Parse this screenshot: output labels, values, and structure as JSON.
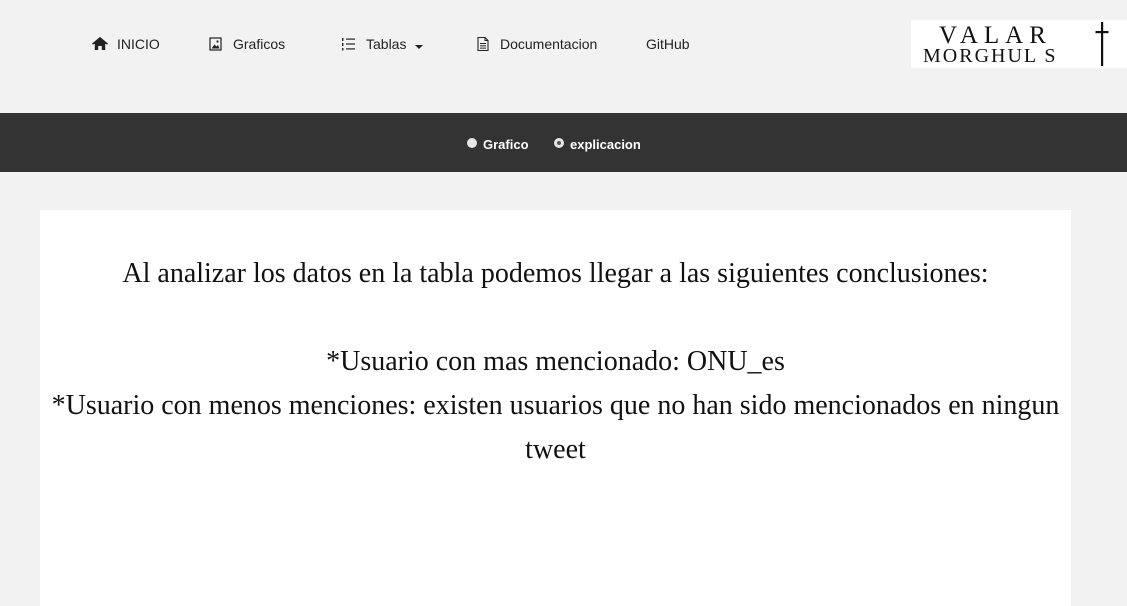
{
  "nav": {
    "items": [
      {
        "label": "INICIO",
        "icon": "home-icon"
      },
      {
        "label": "Graficos",
        "icon": "image-icon"
      },
      {
        "label": "Tablas",
        "icon": "list-icon"
      },
      {
        "label": "Documentacion",
        "icon": "document-icon"
      },
      {
        "label": "GitHub"
      }
    ]
  },
  "logo": {
    "line1": "VALAR",
    "line2": "MORGHUL S"
  },
  "view_toggle": {
    "options": [
      {
        "label": "Grafico",
        "selected": false
      },
      {
        "label": "explicacion",
        "selected": true
      }
    ]
  },
  "content": {
    "intro": "Al analizar los datos en la tabla podemos llegar a las siguientes conclusiones:",
    "point1": "*Usuario con mas mencionado: ONU_es",
    "point2": "*Usuario con menos menciones: existen usuarios que no han sido mencionados en ningun tweet"
  },
  "colors": {
    "background": "#f2f2f2",
    "subbar": "#333333",
    "card": "#ffffff"
  }
}
